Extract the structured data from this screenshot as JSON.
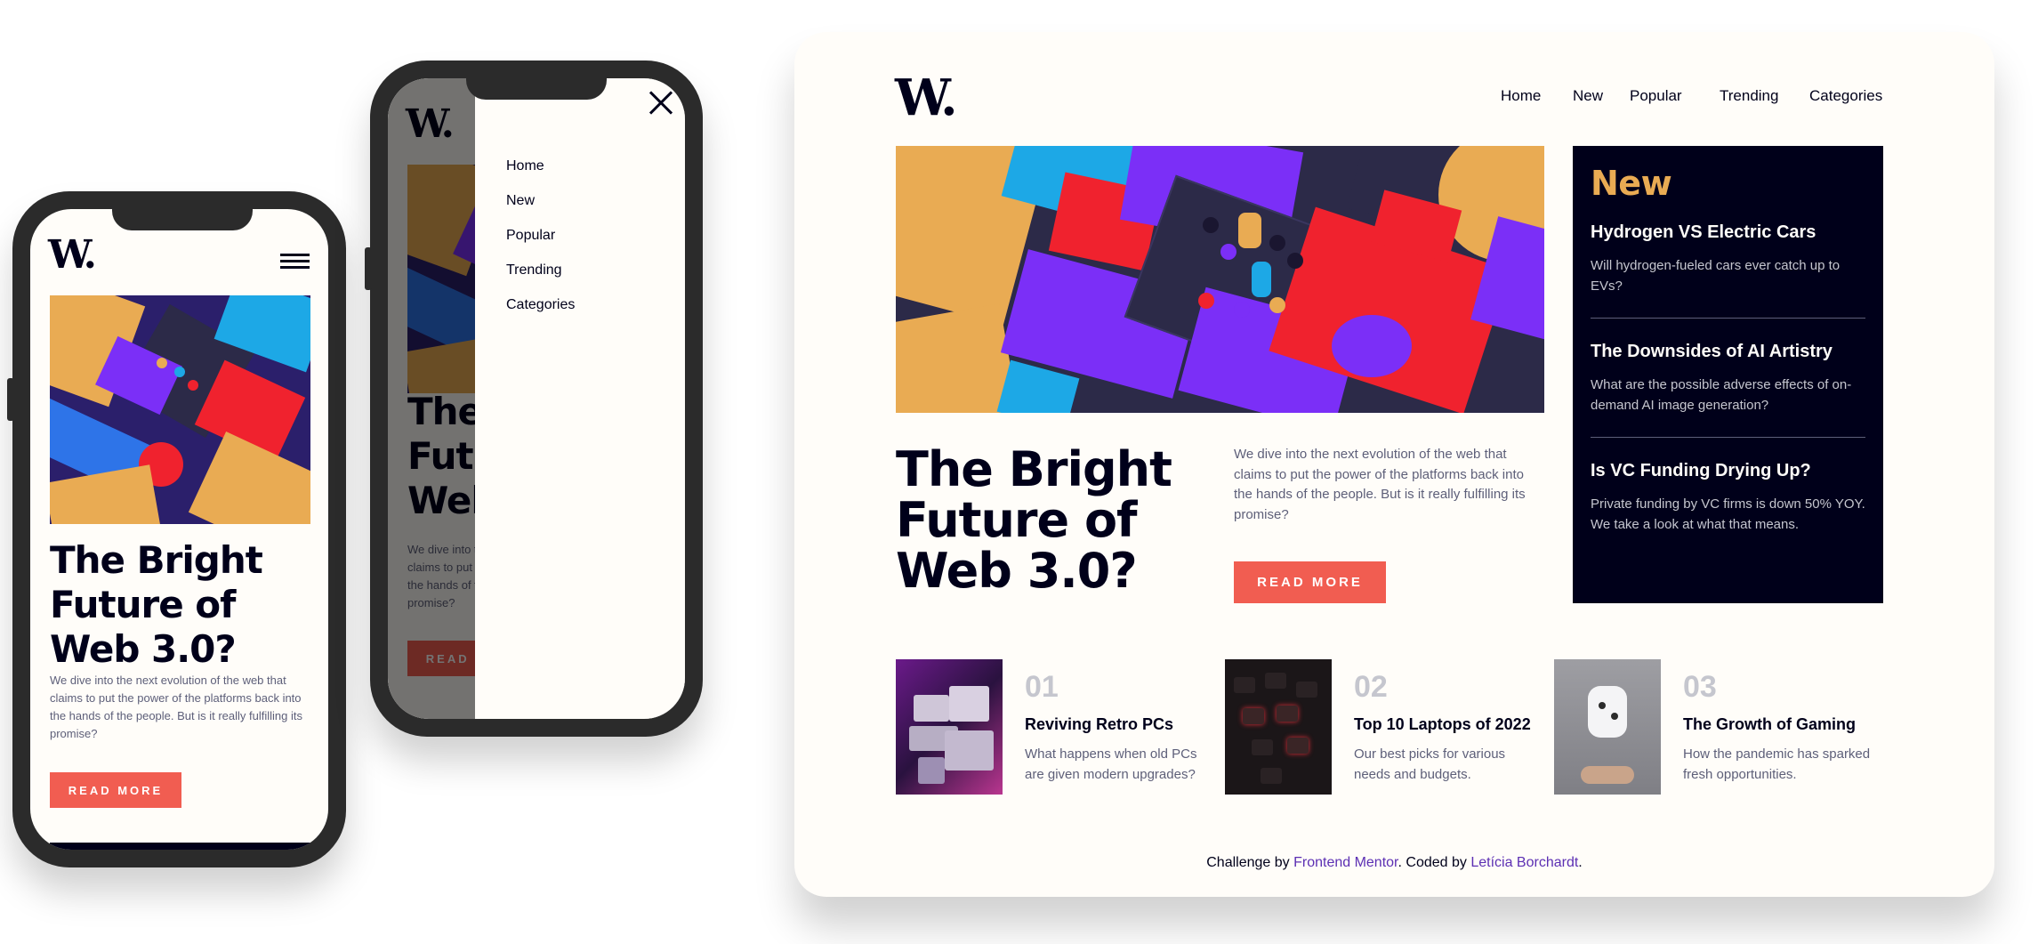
{
  "brand": {
    "logo": "W",
    "logo_dot": "."
  },
  "nav": {
    "items": [
      "Home",
      "New",
      "Popular",
      "Trending",
      "Categories"
    ]
  },
  "hero": {
    "title": "The Bright Future of Web 3.0?",
    "title_lines": [
      "The Bright",
      "Future of",
      "Web 3.0?"
    ],
    "description": "We dive into the next evolution of the web that claims to put the power of the platforms back into the hands of the people. But is it really fulfilling its promise?",
    "button": "READ MORE"
  },
  "new_section": {
    "heading": "New",
    "items": [
      {
        "title": "Hydrogen VS Electric Cars",
        "desc": "Will hydrogen-fueled cars ever catch up to EVs?"
      },
      {
        "title": "The Downsides of AI Artistry",
        "desc": "What are the possible adverse effects of on-demand AI image generation?"
      },
      {
        "title": "Is VC Funding Drying Up?",
        "desc": "Private funding by VC firms is down 50% YOY. We take a look at what that means."
      }
    ]
  },
  "articles": [
    {
      "num": "01",
      "title": "Reviving Retro PCs",
      "desc": "What happens when old PCs are given modern upgrades?"
    },
    {
      "num": "02",
      "title": "Top 10 Laptops of 2022",
      "desc": "Our best picks for various needs and budgets."
    },
    {
      "num": "03",
      "title": "The Growth of Gaming",
      "desc": "How the pandemic has sparked fresh opportunities."
    }
  ],
  "footer": {
    "prefix": "Challenge by ",
    "challenge_link": "Frontend Mentor",
    "middle": ". Coded by ",
    "author_link": "Letícia Borchardt",
    "suffix": "."
  },
  "colors": {
    "accent_red": "#f15d51",
    "accent_orange": "#e9ab53",
    "dark_navy": "#00001a",
    "off_white": "#fffdf9",
    "link_purple": "#5c2fb3"
  },
  "icons": {
    "menu": "hamburger-icon",
    "close": "close-icon"
  }
}
